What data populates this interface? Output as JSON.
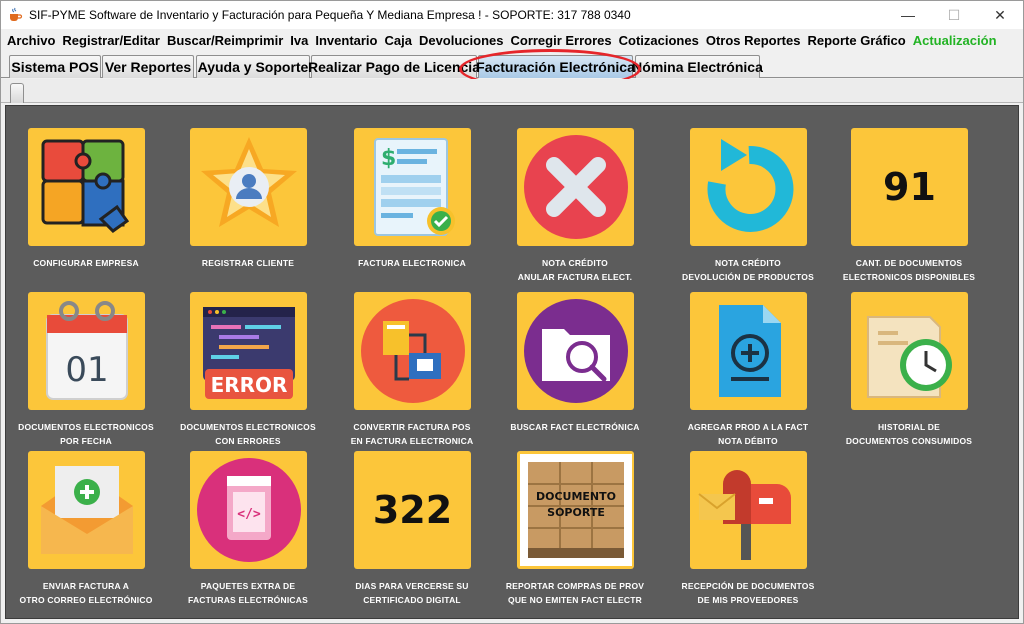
{
  "window": {
    "title": "SIF-PYME Software de Inventario y Facturación para Pequeña Y Mediana Empresa ! -  SOPORTE:  317 788 0340",
    "min_glyph": "—",
    "max_glyph": "☐",
    "close_glyph": "✕"
  },
  "menu": [
    {
      "label": "Archivo"
    },
    {
      "label": "Registrar/Editar"
    },
    {
      "label": "Buscar/Reimprimir"
    },
    {
      "label": "Iva"
    },
    {
      "label": "Inventario"
    },
    {
      "label": "Caja"
    },
    {
      "label": "Devoluciones"
    },
    {
      "label": "Corregir Errores"
    },
    {
      "label": "Cotizaciones"
    },
    {
      "label": "Otros Reportes"
    },
    {
      "label": "Reporte Gráfico"
    },
    {
      "label": "Actualización",
      "color": "#22b324"
    }
  ],
  "tabs": [
    {
      "label": "Sistema POS"
    },
    {
      "label": "Ver Reportes"
    },
    {
      "label": "Ayuda y Soporte"
    },
    {
      "label": "Realizar Pago de Licencia"
    },
    {
      "label": "Facturación Electrónica",
      "active": true
    },
    {
      "label": "Nómina Electrónica"
    }
  ],
  "highlight_color": "#e5262b",
  "tiles": [
    {
      "id": "configurar-empresa",
      "icon": "puzzle-icon",
      "label": "CONFIGURAR EMPRESA"
    },
    {
      "id": "registrar-cliente",
      "icon": "user-star-icon",
      "label": "REGISTRAR CLIENTE"
    },
    {
      "id": "factura-electronica",
      "icon": "invoice-icon",
      "label": "FACTURA ELECTRONICA"
    },
    {
      "id": "nota-credito-anular",
      "icon": "cancel-x-icon",
      "label": "NOTA CRÉDITO\nANULAR FACTURA  ELECT."
    },
    {
      "id": "nota-credito-devolucion",
      "icon": "refresh-arrow-icon",
      "label": "NOTA CRÉDITO\nDEVOLUCIÓN DE PRODUCTOS"
    },
    {
      "id": "cant-documentos",
      "icon": "",
      "number": "91",
      "label": "CANT. DE DOCUMENTOS\nELECTRONICOS DISPONIBLES"
    },
    {
      "id": "documentos-por-fecha",
      "icon": "calendar-icon",
      "calendar_day": "01",
      "label": "DOCUMENTOS ELECTRONICOS\nPOR FECHA"
    },
    {
      "id": "documentos-con-errores",
      "icon": "error-screen-icon",
      "error_text": "ERROR",
      "label": "DOCUMENTOS ELECTRONICOS\nCON ERRORES"
    },
    {
      "id": "convertir-factura-pos",
      "icon": "convert-document-icon",
      "label": "CONVERTIR FACTURA POS\nEN FACTURA ELECTRONICA"
    },
    {
      "id": "buscar-fact-electronica",
      "icon": "folder-search-icon",
      "label": "BUSCAR FACT ELECTRÓNICA"
    },
    {
      "id": "agregar-prod",
      "icon": "document-add-icon",
      "label": "AGREGAR PROD A LA FACT\nNOTA DÉBITO"
    },
    {
      "id": "historial-documentos",
      "icon": "history-clock-icon",
      "label": "HISTORIAL DE\nDOCUMENTOS CONSUMIDOS"
    },
    {
      "id": "enviar-factura-correo",
      "icon": "envelope-add-icon",
      "label": "ENVIAR FACTURA A\nOTRO CORREO ELECTRÓNICO"
    },
    {
      "id": "paquetes-extra",
      "icon": "package-code-icon",
      "label": "PAQUETES EXTRA DE\nFACTURAS ELECTRÓNICAS"
    },
    {
      "id": "dias-certificado",
      "icon": "",
      "number": "322",
      "label": "DIAS PARA VERCERSE SU\nCERTIFICADO DIGITAL"
    },
    {
      "id": "reportar-compras",
      "icon": "boxes-pallet-icon",
      "box_text": "DOCUMENTO\nSOPORTE",
      "label": "REPORTAR COMPRAS DE PROV\nQUE NO EMITEN  FACT ELECTR"
    },
    {
      "id": "recepcion-documentos",
      "icon": "mailbox-icon",
      "label": "RECEPCIÓN DE DOCUMENTOS\nDE MIS PROVEEDORES"
    }
  ]
}
